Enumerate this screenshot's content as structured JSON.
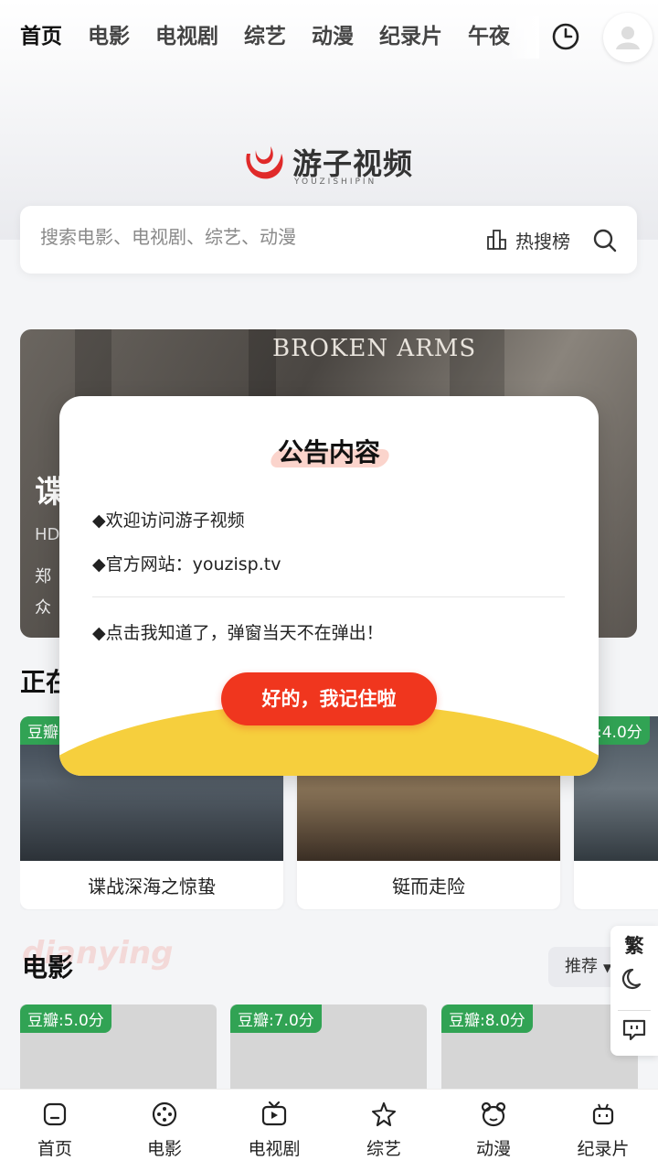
{
  "nav": {
    "tabs": [
      "首页",
      "电影",
      "电视剧",
      "综艺",
      "动漫",
      "纪录片",
      "午夜"
    ],
    "active_tab": 0
  },
  "logo": {
    "text": "游子视频",
    "sub": "YOUZISHIPIN"
  },
  "search": {
    "placeholder": "搜索电影、电视剧、综艺、动漫",
    "hot_label": "热搜榜"
  },
  "banner": {
    "image_title": "BROKEN ARMS",
    "caption_partial": "谍",
    "hd": "HD",
    "line1": "郑",
    "line2": "众"
  },
  "now_showing": {
    "title_partial": "正在",
    "cards": [
      {
        "title": "谍战深海之惊蛰",
        "badge": "豆瓣"
      },
      {
        "title": "铤而走险",
        "badge": ""
      },
      {
        "title": "",
        "badge": "瓣:4.0分"
      }
    ]
  },
  "movies": {
    "title": "电影",
    "ghost": "dianying",
    "sort_label": "推荐",
    "cards": [
      {
        "badge": "豆瓣:5.0分"
      },
      {
        "badge": "豆瓣:7.0分"
      },
      {
        "badge": "豆瓣:8.0分"
      }
    ]
  },
  "float_tools": {
    "traditional": "繁"
  },
  "bottom_nav": [
    "首页",
    "电影",
    "电视剧",
    "综艺",
    "动漫",
    "纪录片"
  ],
  "modal": {
    "title": "公告内容",
    "lines": [
      "◆欢迎访问游子视频",
      "◆官方网站：youzisp.tv"
    ],
    "note": "◆点击我知道了，弹窗当天不在弹出！",
    "button": "好的，我记住啦"
  },
  "colors": {
    "accent": "#f0361e",
    "highlight": "#f7cf3d",
    "badge": "#31a354"
  }
}
